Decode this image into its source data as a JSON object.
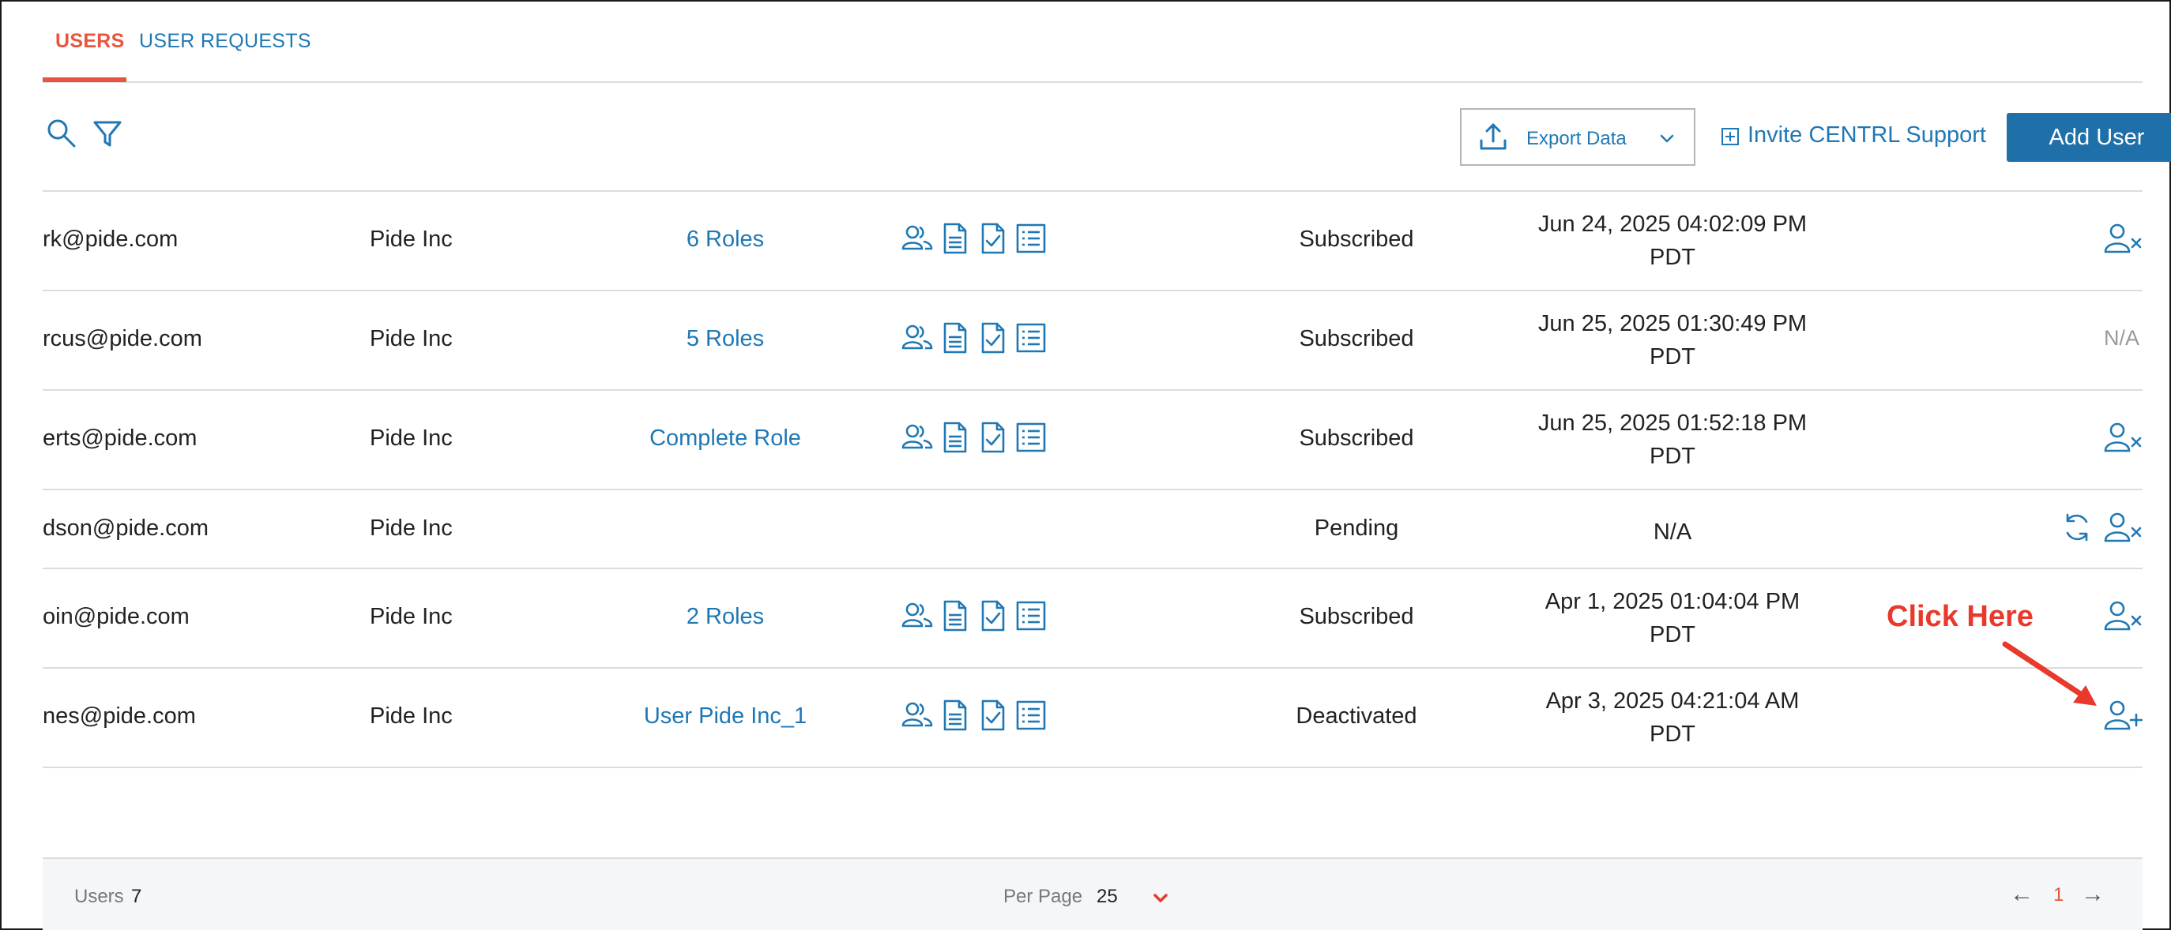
{
  "tabs": [
    {
      "label": "USERS",
      "active": true
    },
    {
      "label": "USER REQUESTS",
      "active": false
    }
  ],
  "toolbar": {
    "search_icon": "search-icon",
    "filter_icon": "filter-icon",
    "export_label": "Export Data",
    "invite_label": "Invite CENTRL Support",
    "add_user_label": "Add User"
  },
  "colors": {
    "accent": "#1f78b4",
    "active_tab": "#e8553d",
    "primary_button": "#1f6fa8",
    "annotation": "#e8392b",
    "muted": "#9a9a9a"
  },
  "rows": [
    {
      "email": "rk@pide.com",
      "company": "Pide Inc",
      "role": "6 Roles",
      "status": "Subscribed",
      "date_line1": "Jun 24, 2025 04:02:09 PM",
      "date_line2": "PDT",
      "actions": [
        "remove-user-icon"
      ]
    },
    {
      "email": "rcus@pide.com",
      "company": "Pide Inc",
      "role": "5 Roles",
      "status": "Subscribed",
      "date_line1": "Jun 25, 2025 01:30:49 PM",
      "date_line2": "PDT",
      "actions": [],
      "action_text": "N/A"
    },
    {
      "email": "erts@pide.com",
      "company": "Pide Inc",
      "role": "Complete Role",
      "status": "Subscribed",
      "date_line1": "Jun 25, 2025 01:52:18 PM",
      "date_line2": "PDT",
      "actions": [
        "remove-user-icon"
      ]
    },
    {
      "email": "dson@pide.com",
      "company": "Pide Inc",
      "role": "",
      "status": "Pending",
      "date_line1": "N/A",
      "date_line2": "",
      "actions": [
        "resend-icon",
        "remove-user-icon"
      ]
    },
    {
      "email": "oin@pide.com",
      "company": "Pide Inc",
      "role": "2 Roles",
      "status": "Subscribed",
      "date_line1": "Apr 1, 2025 01:04:04 PM",
      "date_line2": "PDT",
      "actions": [
        "remove-user-icon"
      ]
    },
    {
      "email": "nes@pide.com",
      "company": "Pide Inc",
      "role": "User Pide Inc_1",
      "status": "Deactivated",
      "date_line1": "Apr 3, 2025 04:21:04 AM",
      "date_line2": "PDT",
      "actions": [
        "add-user-icon"
      ]
    }
  ],
  "permission_icons": [
    "users-icon",
    "document-icon",
    "checked-document-icon",
    "list-icon"
  ],
  "annotation": {
    "text": "Click Here"
  },
  "footer": {
    "users_label": "Users",
    "users_count": "7",
    "per_page_label": "Per Page",
    "per_page_value": "25",
    "prev": "←",
    "page": "1",
    "next": "→"
  }
}
